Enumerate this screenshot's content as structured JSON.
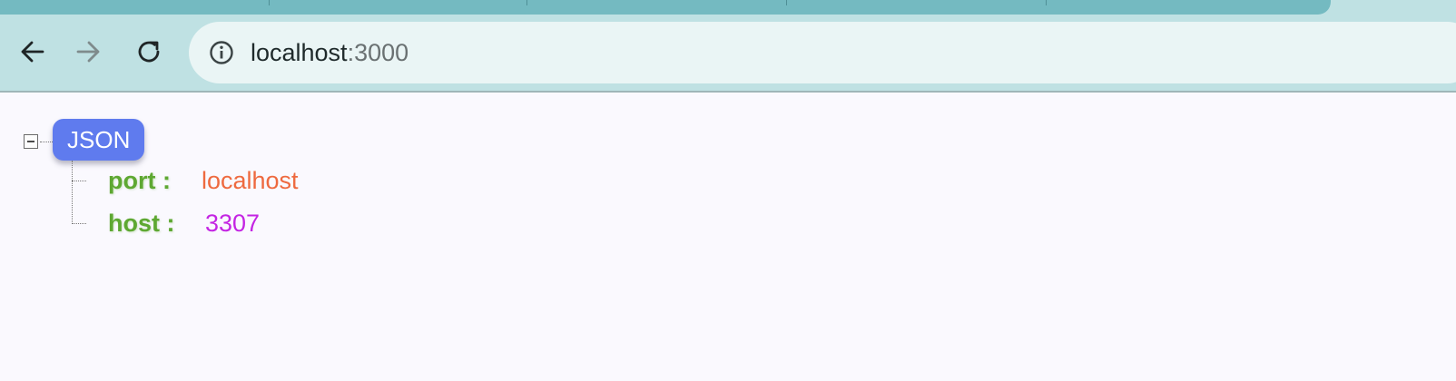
{
  "browser": {
    "address_host": "localhost",
    "address_port": ":3000",
    "icons": {
      "back": "arrow-left-icon",
      "forward": "arrow-right-icon",
      "reload": "reload-icon",
      "site_info": "info-icon"
    },
    "forward_enabled": false
  },
  "viewer": {
    "root_label": "JSON",
    "collapsed": false,
    "entries": [
      {
        "key": "port :",
        "value": "localhost",
        "type": "string"
      },
      {
        "key": "host :",
        "value": "3307",
        "type": "number"
      }
    ]
  },
  "colors": {
    "root_badge": "#5f7bee",
    "key": "#5ea832",
    "string_value": "#ee6a3f",
    "number_value": "#c425e3",
    "toolbar": "#bfe1e3",
    "active_tab": "#74bac1"
  }
}
